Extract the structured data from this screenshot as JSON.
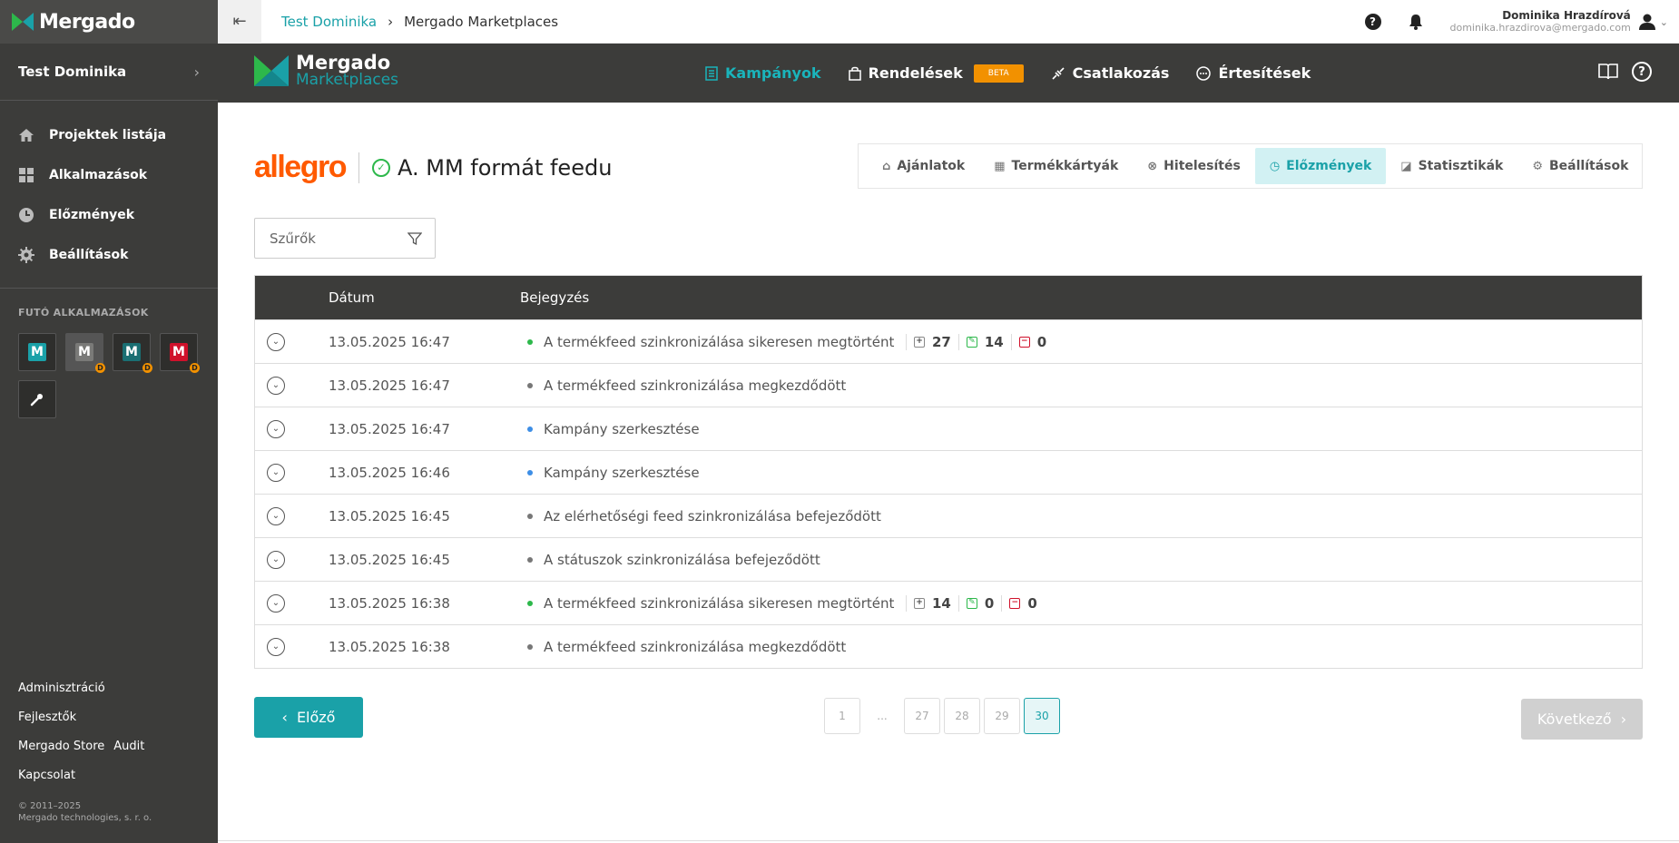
{
  "brand": {
    "name": "Mergado",
    "accent": "#1aa1a8",
    "dark": "#3c3c3a",
    "orange": "#f29100"
  },
  "sidebar": {
    "project": "Test Dominika",
    "nav": [
      {
        "label": "Projektek listája",
        "icon": "home-icon"
      },
      {
        "label": "Alkalmazások",
        "icon": "grid-icon"
      },
      {
        "label": "Előzmények",
        "icon": "clock-icon"
      },
      {
        "label": "Beállítások",
        "icon": "gear-icon"
      }
    ],
    "running_title": "FUTÓ ALKALMAZÁSOK",
    "running_apps": [
      {
        "letter": "M",
        "color": "#1aa1a8",
        "dev": false
      },
      {
        "letter": "M",
        "color": "#7a7a78",
        "dev": true
      },
      {
        "letter": "M",
        "color": "#1a6f73",
        "dev": true
      },
      {
        "letter": "M",
        "color": "#d0112b",
        "dev": true
      }
    ],
    "dev_badge": "D",
    "footer": {
      "admin": "Adminisztráció",
      "dev": "Fejlesztők",
      "store": "Mergado Store",
      "audit": "Audit",
      "contact": "Kapcsolat"
    },
    "copyright1": "© 2011–2025",
    "copyright2": "Mergado technologies, s. r. o."
  },
  "topbar": {
    "crumb1": "Test Dominika",
    "crumb2": "Mergado Marketplaces",
    "user_name": "Dominika Hrazdírová",
    "user_email": "dominika.hrazdirova@mergado.com"
  },
  "mainbar": {
    "logo1": "Mergado",
    "logo2": "Marketplaces",
    "items": [
      "Kampányok",
      "Rendelések",
      "Csatlakozás",
      "Értesítések"
    ],
    "beta": "BETA"
  },
  "campaign": {
    "marketplace": "allegro",
    "name": "A. MM formát feedu"
  },
  "tabs": [
    "Ajánlatok",
    "Termékkártyák",
    "Hitelesítés",
    "Előzmények",
    "Statisztikák",
    "Beállítások"
  ],
  "filter": {
    "label": "Szűrők"
  },
  "table": {
    "headers": {
      "date": "Dátum",
      "entry": "Bejegyzés"
    },
    "rows": [
      {
        "date": "13.05.2025 16:47",
        "text": "A termékfeed szinkronizálása sikeresen megtörtént",
        "dot": "#2db84b",
        "stats": {
          "added": "27",
          "edited": "14",
          "removed": "0"
        }
      },
      {
        "date": "13.05.2025 16:47",
        "text": "A termékfeed szinkronizálása megkezdődött",
        "dot": "#777777"
      },
      {
        "date": "13.05.2025 16:47",
        "text": "Kampány szerkesztése",
        "dot": "#3d8ee6"
      },
      {
        "date": "13.05.2025 16:46",
        "text": "Kampány szerkesztése",
        "dot": "#3d8ee6"
      },
      {
        "date": "13.05.2025 16:45",
        "text": "Az elérhetőségi feed szinkronizálása befejeződött",
        "dot": "#777777"
      },
      {
        "date": "13.05.2025 16:45",
        "text": "A státuszok szinkronizálása befejeződött",
        "dot": "#777777"
      },
      {
        "date": "13.05.2025 16:38",
        "text": "A termékfeed szinkronizálása sikeresen megtörtént",
        "dot": "#2db84b",
        "stats": {
          "added": "14",
          "edited": "0",
          "removed": "0"
        }
      },
      {
        "date": "13.05.2025 16:38",
        "text": "A termékfeed szinkronizálása megkezdődött",
        "dot": "#777777"
      }
    ]
  },
  "pagination": {
    "prev": "Előző",
    "next": "Következő",
    "pages": [
      "1",
      "...",
      "27",
      "28",
      "29",
      "30"
    ],
    "current": "30"
  }
}
